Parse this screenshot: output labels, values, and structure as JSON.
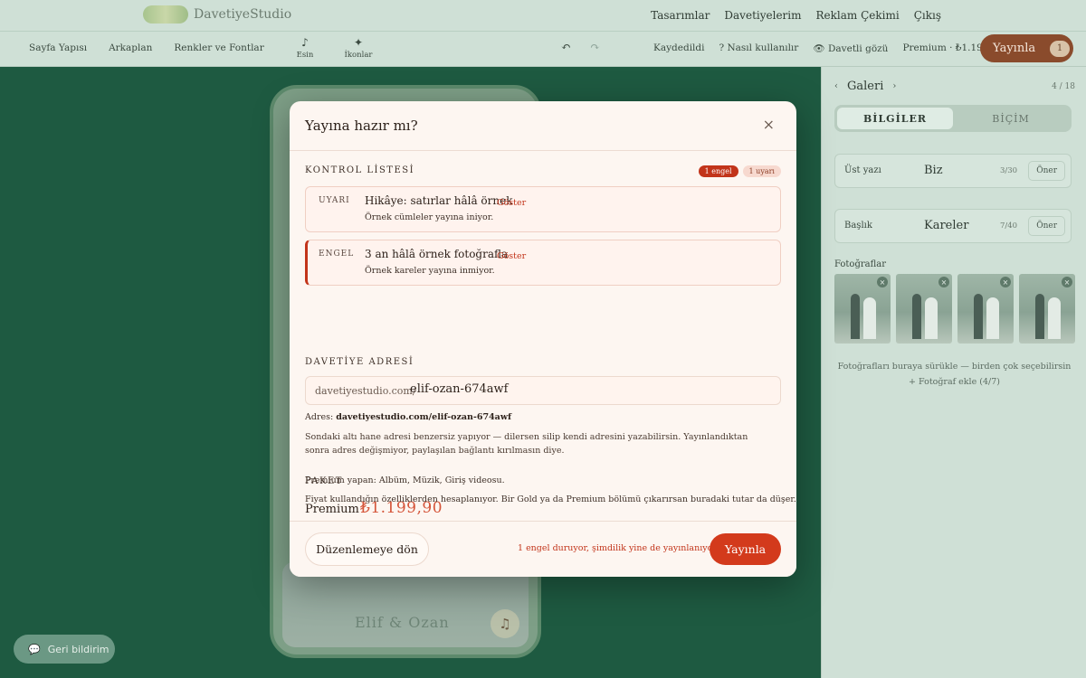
{
  "brand": {
    "name": "DavetiyeStudio"
  },
  "topnav": [
    "Tasarımlar",
    "Davetiyelerim",
    "Reklam Çekimi",
    "Çıkış"
  ],
  "toolbar": {
    "left": [
      "Sayfa Yapısı",
      "Arkaplan",
      "Renkler ve Fontlar"
    ],
    "tools": [
      {
        "icon": "♪",
        "label": "Esin"
      },
      {
        "icon": "✦",
        "label": "İkonlar"
      }
    ],
    "undo": "↶",
    "redo": "↷",
    "saved": "Kaydedildi",
    "help": "? Nasıl kullanılır",
    "guest_view": "👁 Davetli gözü",
    "premium": "Premium · ₺1.199,90",
    "publish": "Yayınla",
    "publish_count": "1"
  },
  "phone": {
    "name": "Elif & Ozan",
    "music_icon": "♫"
  },
  "feedback": {
    "icon": "💬",
    "label": "Geri bildirim"
  },
  "panel": {
    "title": "Galeri",
    "prev": "‹",
    "next": "›",
    "count": "4 / 18",
    "tabs": [
      "BİLGİLER",
      "BİÇİM"
    ],
    "fields": [
      {
        "label": "Üst yazı",
        "value": "Biz",
        "count": "3/30",
        "suggest": "Öner"
      },
      {
        "label": "Başlık",
        "value": "Kareler",
        "count": "7/40",
        "suggest": "Öner"
      }
    ],
    "photos_label": "Fotoğraflar",
    "photo_remove": "×",
    "drop_hint": "Fotoğrafları buraya sürükle — birden çok seçebilirsin",
    "add_photo": "+ Fotoğraf ekle (4/7)"
  },
  "modal": {
    "title": "Yayına hazır mı?",
    "close": "×",
    "checklist_title": "KONTROL LİSTESİ",
    "badge_block": "1 engel",
    "badge_warn": "1 uyarı",
    "checks": [
      {
        "kind": "UYARI",
        "title": "Hikâye: satırlar hâlâ örnek",
        "desc": "Örnek cümleler yayına iniyor.",
        "action": "Göster"
      },
      {
        "kind": "ENGEL",
        "title": "3 an hâlâ örnek fotoğrafla",
        "desc": "Örnek kareler yayına inmiyor.",
        "action": "Göster"
      }
    ],
    "address_title": "DAVETİYE ADRESİ",
    "address_prefix": "davetiyestudio.com/",
    "address_slug": "elif-ozan-674awf",
    "address_label": "Adres:",
    "address_full": "davetiyestudio.com/elif-ozan-674awf",
    "address_help": "Sondaki altı hane adresi benzersiz yapıyor — dilersen silip kendi adresini yazabilirsin. Yayınlandıktan sonra adres değişmiyor, paylaşılan bağlantı kırılmasın diye.",
    "package_title": "PAKET",
    "package_name": "Premium",
    "package_price": "₺1.199,90",
    "package_desc": "Premium yapan: Albüm, Müzik, Giriş videosu.",
    "package_note": "Fiyat kullandığın özelliklerden hesaplanıyor. Bir Gold ya da Premium bölümü çıkarırsan buradaki tutar da düşer.",
    "back": "Düzenlemeye dön",
    "warn": "1 engel duruyor, şimdilik yine de yayınlanıyor",
    "publish": "Yayınla"
  },
  "colors": {
    "accent": "#d33a1c",
    "canvas": "#1e5a41",
    "publish_top": "#8a4b2c"
  }
}
